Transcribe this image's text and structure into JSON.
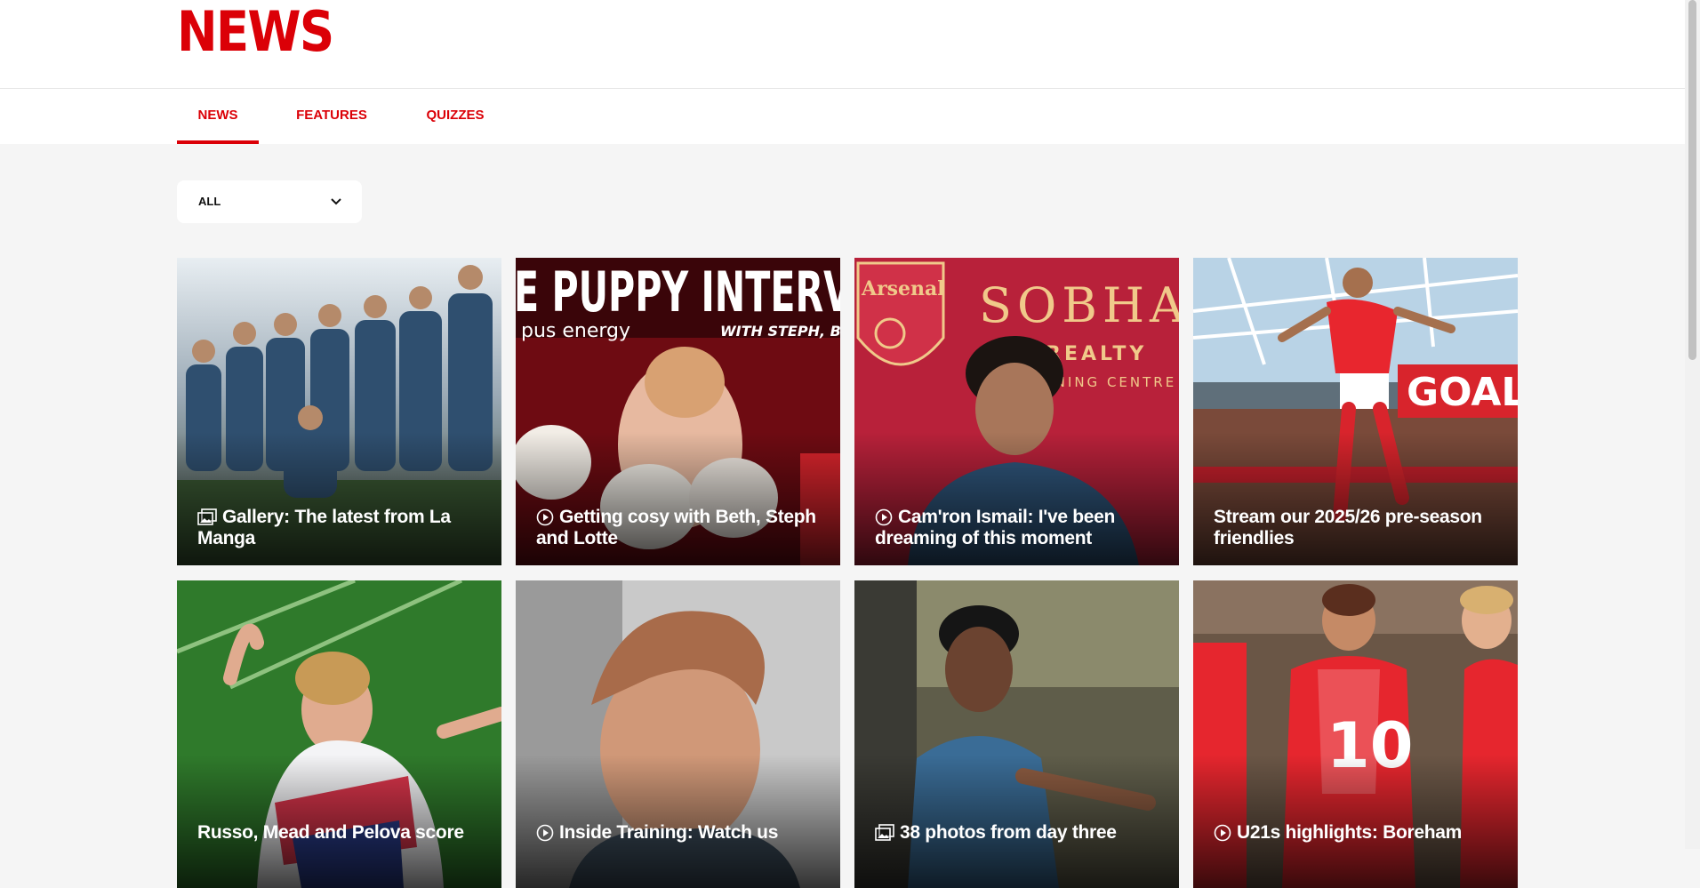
{
  "header": {
    "title": "NEWS"
  },
  "tabs": [
    {
      "label": "NEWS",
      "active": true
    },
    {
      "label": "FEATURES",
      "active": false
    },
    {
      "label": "QUIZZES",
      "active": false
    }
  ],
  "filter": {
    "selected": "ALL",
    "icon": "chevron-down-icon"
  },
  "cards": [
    {
      "title": "Gallery: The latest from La Manga",
      "icon": "gallery-icon"
    },
    {
      "title": "Getting cosy with Beth, Steph and Lotte",
      "icon": "play-icon",
      "image_text": {
        "headline": "E PUPPY INTERV",
        "sponsor": "pus energy",
        "byline": "WITH STEPH, BET"
      }
    },
    {
      "title": "Cam'ron Ismail: I've been dreaming of this moment",
      "icon": "play-icon",
      "image_text": {
        "club": "Arsenal",
        "sponsor": "SOBHA",
        "sub": "REALTY",
        "sub2": "AINING CENTRE"
      }
    },
    {
      "title": "Stream our 2025/26 pre-season friendlies",
      "icon": "",
      "image_text": {
        "board": "GOAL"
      }
    },
    {
      "title": "Russo, Mead and Pelova score",
      "icon": ""
    },
    {
      "title": "Inside Training: Watch us",
      "icon": "play-icon"
    },
    {
      "title": "38 photos from day three",
      "icon": "gallery-icon"
    },
    {
      "title": "U21s highlights: Boreham",
      "icon": "play-icon"
    }
  ],
  "colors": {
    "accent": "#db0007",
    "page_bg": "#f5f5f5"
  }
}
